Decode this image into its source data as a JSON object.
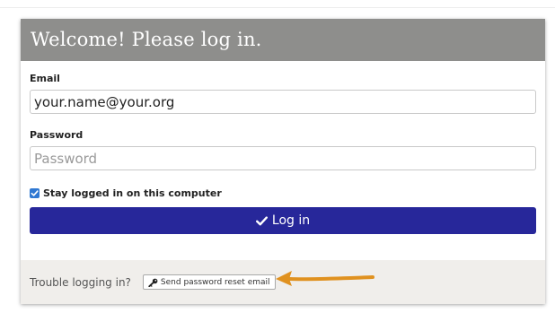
{
  "header": {
    "title": "Welcome! Please log in."
  },
  "form": {
    "email_label": "Email",
    "email_value": "your.name@your.org",
    "password_label": "Password",
    "password_placeholder": "Password",
    "stay_logged_in_label": "Stay logged in on this computer",
    "stay_logged_in_checked": true,
    "login_button_label": "Log in"
  },
  "footer": {
    "trouble_text": "Trouble logging in?",
    "reset_button_label": "Send password reset email"
  },
  "colors": {
    "header_bg": "#8e8e8c",
    "login_button_bg": "#27279a",
    "checkbox": "#2f78d2",
    "footer_bg": "#f0eeeb",
    "annotation_arrow": "#e0911f"
  },
  "icons": {
    "login_button_icon": "check-icon",
    "reset_button_icon": "key-icon",
    "annotation": "arrow-left-icon"
  }
}
